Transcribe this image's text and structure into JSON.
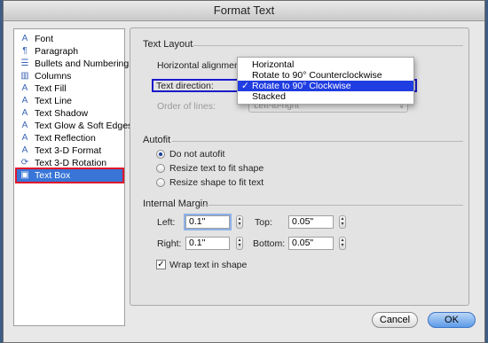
{
  "window": {
    "title": "Format Text"
  },
  "sidebar": {
    "items": [
      {
        "label": "Font",
        "icon": "font-icon"
      },
      {
        "label": "Paragraph",
        "icon": "paragraph-icon"
      },
      {
        "label": "Bullets and Numbering",
        "icon": "bullets-icon"
      },
      {
        "label": "Columns",
        "icon": "columns-icon"
      },
      {
        "label": "Text Fill",
        "icon": "text-fill-icon"
      },
      {
        "label": "Text Line",
        "icon": "text-line-icon"
      },
      {
        "label": "Text Shadow",
        "icon": "text-shadow-icon"
      },
      {
        "label": "Text Glow & Soft Edges",
        "icon": "text-glow-icon"
      },
      {
        "label": "Text Reflection",
        "icon": "text-reflection-icon"
      },
      {
        "label": "Text 3-D Format",
        "icon": "text-3d-format-icon"
      },
      {
        "label": "Text 3-D Rotation",
        "icon": "text-3d-rotation-icon"
      },
      {
        "label": "Text Box",
        "icon": "text-box-icon"
      }
    ],
    "selected": "Text Box"
  },
  "text_layout": {
    "title": "Text Layout",
    "horizontal_alignment_label": "Horizontal alignment:",
    "text_direction_label": "Text direction:",
    "order_of_lines_label": "Order of lines:",
    "order_of_lines_value": "Left-to-right",
    "dropdown_options": [
      "Horizontal",
      "Rotate to 90° Counterclockwise",
      "Rotate to 90° Clockwise",
      "Stacked"
    ],
    "dropdown_selected": "Rotate to 90° Clockwise",
    "check_mark": "✓"
  },
  "autofit": {
    "title": "Autofit",
    "options": [
      "Do not autofit",
      "Resize text to fit shape",
      "Resize shape to fit text"
    ],
    "selected": "Do not autofit"
  },
  "internal_margin": {
    "title": "Internal Margin",
    "left_label": "Left:",
    "left_value": "0.1\"",
    "top_label": "Top:",
    "top_value": "0.05\"",
    "right_label": "Right:",
    "right_value": "0.1\"",
    "bottom_label": "Bottom:",
    "bottom_value": "0.05\""
  },
  "wrap": {
    "label": "Wrap text in shape",
    "checked": true
  },
  "buttons": {
    "cancel": "Cancel",
    "ok": "OK"
  }
}
